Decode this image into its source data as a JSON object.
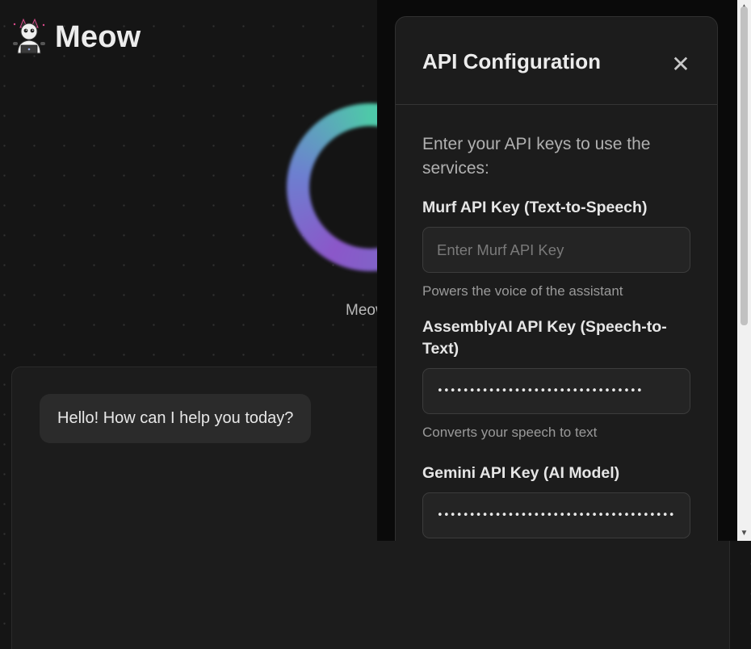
{
  "app": {
    "title": "Meow",
    "logo_icon": "robot-cat-laptop-icon"
  },
  "orb": {
    "status_text": "Meow"
  },
  "chat": {
    "messages": [
      {
        "role": "assistant",
        "text": "Hello! How can I help you today?"
      }
    ]
  },
  "modal": {
    "title": "API Configuration",
    "close_icon": "close-icon",
    "intro": "Enter your API keys to use the services:",
    "fields": [
      {
        "label": "Murf API Key (Text-to-Speech)",
        "placeholder": "Enter Murf API Key",
        "value": "",
        "help": "Powers the voice of the assistant"
      },
      {
        "label": "AssemblyAI API Key (Speech-to-Text)",
        "placeholder": "",
        "value": "••••••••••••••••••••••••••••••••",
        "help": "Converts your speech to text"
      },
      {
        "label": "Gemini API Key (AI Model)",
        "placeholder": "",
        "value": "•••••••••••••••••••••••••••••••••••••••",
        "help": ""
      }
    ]
  },
  "colors": {
    "background": "#151515",
    "panel": "#1c1c1c",
    "orb_teal": "#4ec9a8",
    "orb_purple": "#8b57c9"
  }
}
